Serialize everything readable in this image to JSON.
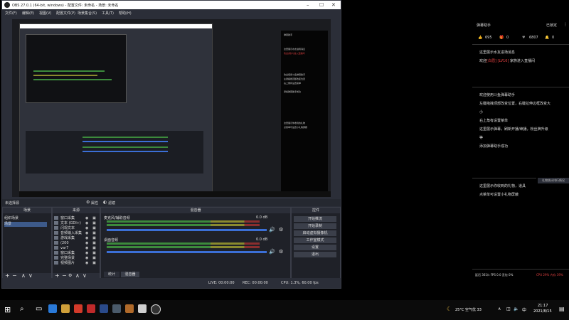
{
  "obs": {
    "title": "OBS 27.0.1 (64-bit, windows) - 配置文件: 未命名 - 场景: 未命名",
    "menu": [
      "文件(F)",
      "编辑(E)",
      "视图(V)",
      "配置文件(P)",
      "场景集合(S)",
      "工具(T)",
      "帮助(H)"
    ],
    "no_source": "未选择源",
    "properties": "属性",
    "filters": "滤镜",
    "docks": {
      "scenes": {
        "title": "场景",
        "items": [
          "组织场景",
          "场景"
        ],
        "selected": 1
      },
      "sources": {
        "title": "来源",
        "items": [
          "窗口采集",
          "文本 (GDI+)",
          "闪现文本",
          "音频输入采集",
          "游戏采集",
          "(200",
          "var7",
          "窗口采集",
          "完整场景",
          "视频图片"
        ]
      },
      "mixer": {
        "title": "混音器",
        "tracks": [
          {
            "name": "麦克风/辅助音频",
            "level": "0.0 dB"
          },
          {
            "name": "桌面音频",
            "level": "0.0 dB"
          }
        ],
        "tabs": [
          "统计",
          "混音器"
        ]
      },
      "transitions": {
        "title": "转场特效"
      },
      "controls": {
        "title": "控件",
        "buttons": [
          "开始推流",
          "开始录制",
          "启动虚拟摄像机",
          "工作室模式",
          "设置",
          "退出"
        ]
      }
    },
    "status": "CPU: 1.3%, 60.00 fps",
    "live": "LIVE: 00:00:00",
    "rec": "REC: 00:00:00"
  },
  "mini": {
    "danmaku_lines": [
      "弹幕助手",
      "这里展示水友进场消息",
      "欢迎[用户]进入直播间",
      "欢迎使用斗鱼弹幕助手",
      "左键拖拽顶部改变位置",
      "右上角有设置菜单",
      "添加弹幕助手成功",
      "这里展示你收到的礼物",
      "点菜单可设置小礼物屏蔽"
    ]
  },
  "right_panel": {
    "header_title": "弹幕助手",
    "header_right": "已锁定",
    "stats": [
      "695",
      "0",
      "6807",
      "0"
    ],
    "msg1_title": "这里展示水友进场消息",
    "msg1_prefix": "欢迎",
    "msg1_user": "[白眉] [LV16] ",
    "msg1_suffix": "家族进入直播间",
    "guide": [
      "欢迎使用斗鱼弹幕助手",
      "左键拖拽顶部改变位置，右键拉伸边框改变大",
      "小",
      "右上角有设置菜单",
      "这里展示弹幕，刷新开播/续播，粉丝牌升级",
      "等",
      "添加弹幕助手成功"
    ],
    "gift_tag": "礼物统计排行情况",
    "gift1": "这里展示你收到的礼物，道具",
    "gift2": "点菜单可设置小礼物屏蔽",
    "footer_left": "延迟 361/s  FPS 0.0  丢包 0%",
    "footer_right": "CPU 29%  内存 39%"
  },
  "taskbar": {
    "weather": "25°C 空气优 33",
    "lang": "中",
    "time": "21:17",
    "date": "2021/8/15"
  }
}
